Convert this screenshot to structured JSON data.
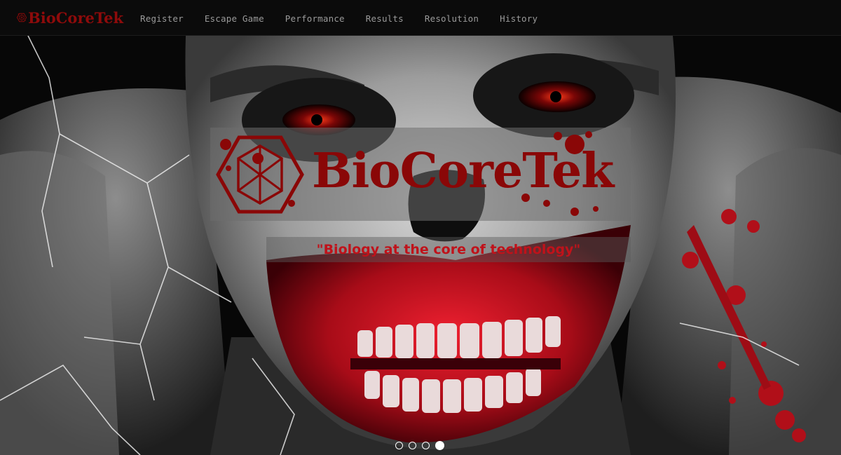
{
  "brand": {
    "name": "BioCoreTek",
    "logo_icon": "hexagon-cube-logo-icon",
    "color": "#8e0b0b"
  },
  "nav": {
    "items": [
      {
        "label": "Register"
      },
      {
        "label": "Escape Game"
      },
      {
        "label": "Performance"
      },
      {
        "label": "Results"
      },
      {
        "label": "Resolution"
      },
      {
        "label": "History"
      }
    ]
  },
  "hero": {
    "title": "BioCoreTek",
    "tagline": "\"Biology at the core of technology\"",
    "accent_color": "#8a0707",
    "tagline_color": "#c0121a",
    "carousel": {
      "slide_count": 4,
      "active_slide": 4
    }
  }
}
